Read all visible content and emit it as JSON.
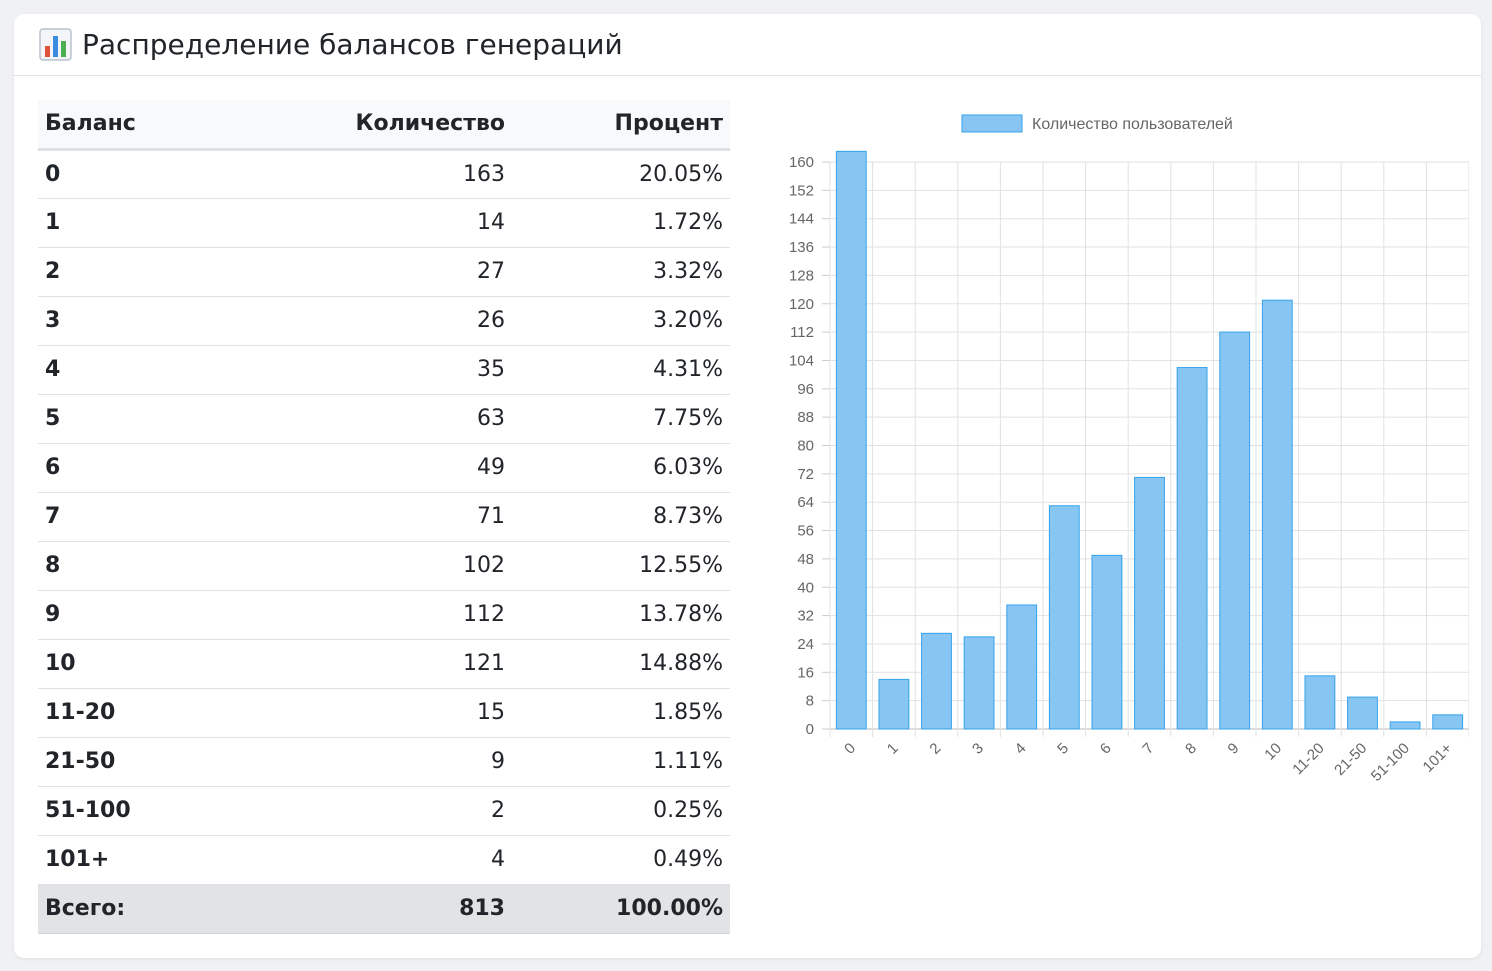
{
  "header": {
    "icon": "bar-chart-icon",
    "title": "Распределение балансов генераций"
  },
  "table": {
    "columns": [
      "Баланс",
      "Количество",
      "Процент"
    ],
    "rows": [
      {
        "balance": "0",
        "count": "163",
        "percent": "20.05%"
      },
      {
        "balance": "1",
        "count": "14",
        "percent": "1.72%"
      },
      {
        "balance": "2",
        "count": "27",
        "percent": "3.32%"
      },
      {
        "balance": "3",
        "count": "26",
        "percent": "3.20%"
      },
      {
        "balance": "4",
        "count": "35",
        "percent": "4.31%"
      },
      {
        "balance": "5",
        "count": "63",
        "percent": "7.75%"
      },
      {
        "balance": "6",
        "count": "49",
        "percent": "6.03%"
      },
      {
        "balance": "7",
        "count": "71",
        "percent": "8.73%"
      },
      {
        "balance": "8",
        "count": "102",
        "percent": "12.55%"
      },
      {
        "balance": "9",
        "count": "112",
        "percent": "13.78%"
      },
      {
        "balance": "10",
        "count": "121",
        "percent": "14.88%"
      },
      {
        "balance": "11-20",
        "count": "15",
        "percent": "1.85%"
      },
      {
        "balance": "21-50",
        "count": "9",
        "percent": "1.11%"
      },
      {
        "balance": "51-100",
        "count": "2",
        "percent": "0.25%"
      },
      {
        "balance": "101+",
        "count": "4",
        "percent": "0.49%"
      }
    ],
    "total": {
      "label": "Всего:",
      "count": "813",
      "percent": "100.00%"
    }
  },
  "chart_data": {
    "type": "bar",
    "categories": [
      "0",
      "1",
      "2",
      "3",
      "4",
      "5",
      "6",
      "7",
      "8",
      "9",
      "10",
      "11-20",
      "21-50",
      "51-100",
      "101+"
    ],
    "series": [
      {
        "name": "Количество пользователей",
        "values": [
          163,
          14,
          27,
          26,
          35,
          63,
          49,
          71,
          102,
          112,
          121,
          15,
          9,
          2,
          4
        ]
      }
    ],
    "ylim": [
      0,
      160
    ],
    "yticks": [
      0,
      8,
      16,
      24,
      32,
      40,
      48,
      56,
      64,
      72,
      80,
      88,
      96,
      104,
      112,
      120,
      128,
      136,
      144,
      152,
      160
    ],
    "legend_position": "top",
    "grid": true,
    "colors": {
      "fill": "#87c6f3",
      "stroke": "#36a2eb"
    }
  }
}
